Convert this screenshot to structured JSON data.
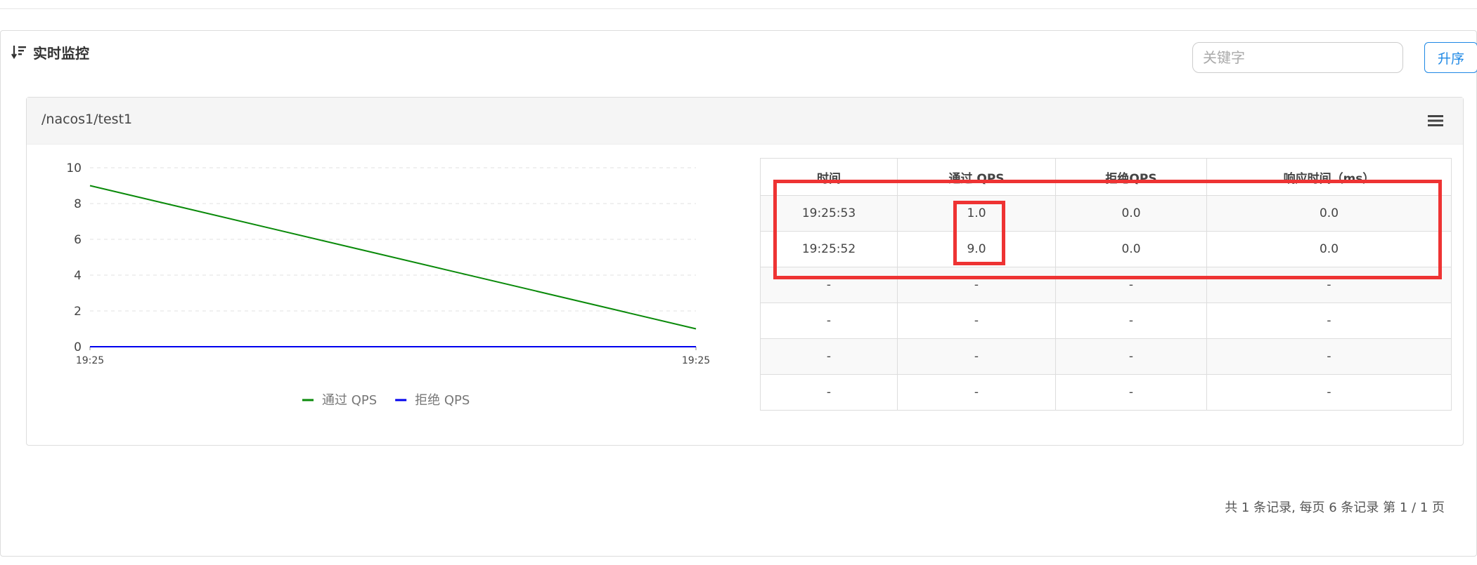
{
  "panel": {
    "title": "实时监控",
    "search_placeholder": "关键字",
    "sort_label": "升序"
  },
  "resource": {
    "name": "/nacos1/test1"
  },
  "chart_data": {
    "type": "line",
    "x": [
      "19:25",
      "19:25"
    ],
    "x_tick_labels": [
      "19:25",
      "19:25"
    ],
    "series": [
      {
        "name": "通过 QPS",
        "values": [
          9,
          1
        ],
        "color": "#0a8a0a"
      },
      {
        "name": "拒绝 QPS",
        "values": [
          0,
          0
        ],
        "color": "#0000ee"
      }
    ],
    "ylim": [
      0,
      10
    ],
    "yticks": [
      0,
      2,
      4,
      6,
      8,
      10
    ],
    "grid": true,
    "legend": "bottom"
  },
  "table": {
    "headers": [
      "时间",
      "通过 QPS",
      "拒绝QPS",
      "响应时间（ms）"
    ],
    "rows": [
      [
        "19:25:53",
        "1.0",
        "0.0",
        "0.0"
      ],
      [
        "19:25:52",
        "9.0",
        "0.0",
        "0.0"
      ],
      [
        "-",
        "-",
        "-",
        "-"
      ],
      [
        "-",
        "-",
        "-",
        "-"
      ],
      [
        "-",
        "-",
        "-",
        "-"
      ],
      [
        "-",
        "-",
        "-",
        "-"
      ]
    ]
  },
  "pagination": {
    "text": "共 1 条记录, 每页 6 条记录 第 1 / 1 页"
  },
  "colors": {
    "highlight": "#ee3333",
    "accent": "#1e88e5"
  }
}
